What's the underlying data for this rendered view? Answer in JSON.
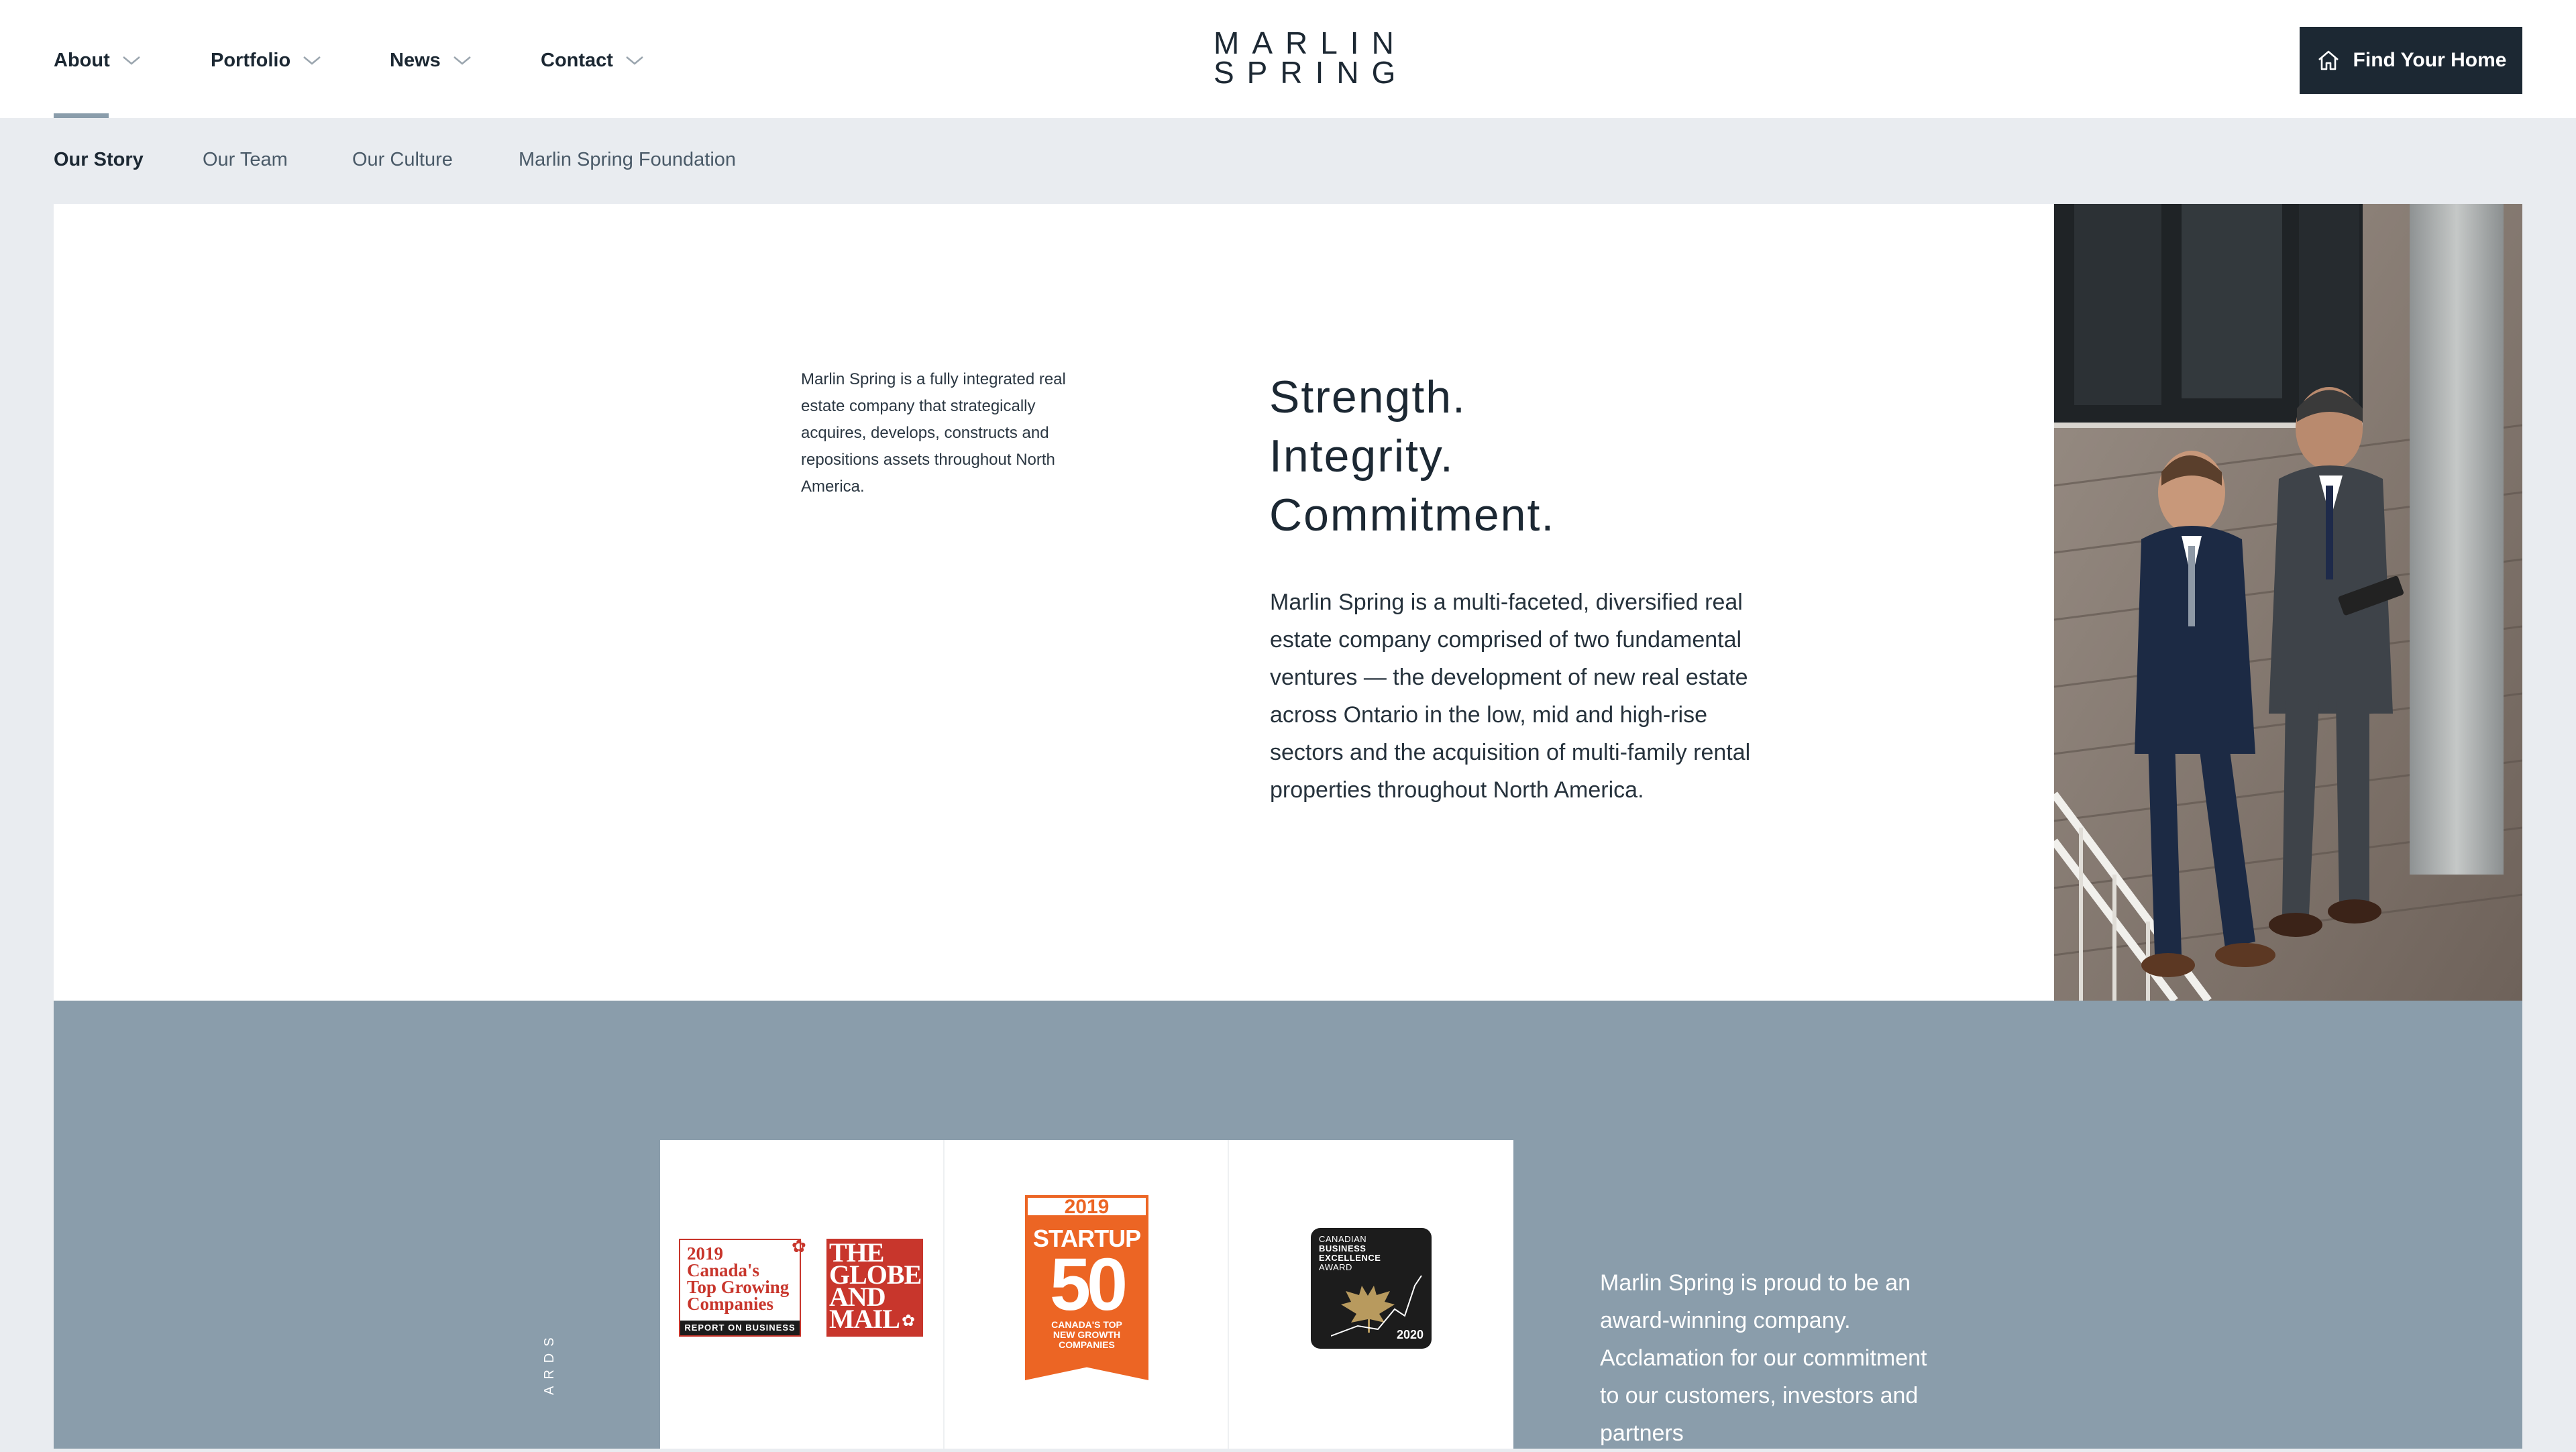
{
  "header": {
    "nav": [
      {
        "label": "About"
      },
      {
        "label": "Portfolio"
      },
      {
        "label": "News"
      },
      {
        "label": "Contact"
      }
    ],
    "logo": {
      "line1": "MARLIN",
      "line2": "SPRING"
    },
    "cta_label": "Find Your Home"
  },
  "subnav": {
    "items": [
      {
        "label": "Our Story"
      },
      {
        "label": "Our Team"
      },
      {
        "label": "Our Culture"
      },
      {
        "label": "Marlin Spring Foundation"
      }
    ]
  },
  "story": {
    "intro": "Marlin Spring is a fully integrated real estate company that strategically acquires, develops, constructs and repositions assets throughout North America.",
    "values": [
      "Strength.",
      "Integrity.",
      "Commitment."
    ],
    "description": "Marlin Spring is a multi-faceted, diversified real estate company comprised of two fundamental ventures — the development of new real estate across Ontario in the low, mid and high-rise sectors and the acquisition of multi-family rental properties throughout North America."
  },
  "awards": {
    "vertical_label": "ARDS",
    "text": "Marlin Spring is proud to be an award-winning company. Acclamation for our commitment to our customers, investors and partners",
    "badge1": {
      "line1": "2019",
      "line2": "Canada's",
      "line3": "Top Growing",
      "line4": "Companies",
      "bar": "REPORT ON BUSINESS",
      "paper_line1": "THE",
      "paper_line2": "GLOBE",
      "paper_line3": "AND",
      "paper_line4": "MAIL"
    },
    "badge2": {
      "year": "2019",
      "word": "STARTUP",
      "number": "50",
      "sub1": "CANADA'S TOP",
      "sub2": "NEW GROWTH",
      "sub3": "COMPANIES"
    },
    "badge3": {
      "line1": "CANADIAN",
      "line2": "BUSINESS",
      "line3": "EXCELLENCE",
      "line4": "AWARD",
      "year": "2020"
    }
  },
  "colors": {
    "navy": "#1c2833",
    "slate": "#8a9dab",
    "background": "#e9ecf0",
    "award_red": "#c8362c",
    "award_orange": "#ec6524"
  },
  "icons": [
    "chevron-down-icon",
    "home-icon"
  ]
}
